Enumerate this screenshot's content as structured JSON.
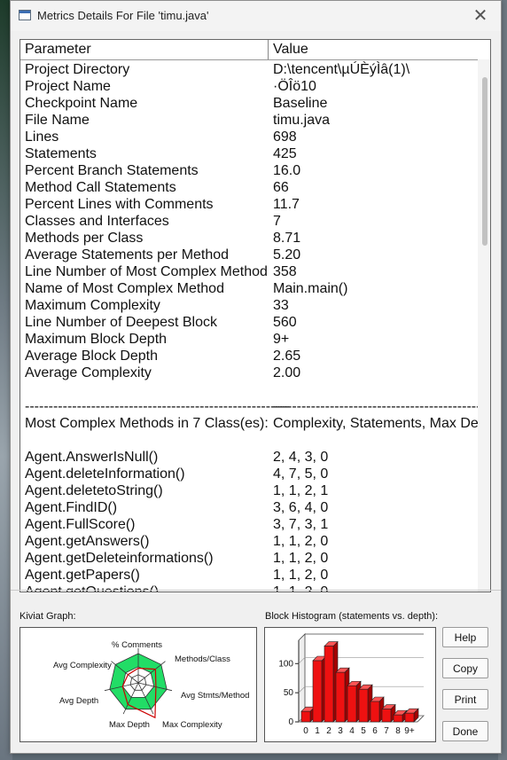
{
  "window": {
    "title": "Metrics Details For File 'timu.java'"
  },
  "table": {
    "headers": {
      "parameter": "Parameter",
      "value": "Value"
    },
    "rows": [
      {
        "p": "Project Directory",
        "v": "D:\\tencent\\µÚÈýÌâ(1)\\"
      },
      {
        "p": "Project Name",
        "v": "·ÖÎö10"
      },
      {
        "p": "Checkpoint Name",
        "v": "Baseline"
      },
      {
        "p": "File Name",
        "v": "timu.java"
      },
      {
        "p": "Lines",
        "v": "698"
      },
      {
        "p": "Statements",
        "v": "425"
      },
      {
        "p": "Percent Branch Statements",
        "v": "16.0"
      },
      {
        "p": "Method Call Statements",
        "v": "66"
      },
      {
        "p": "Percent Lines with Comments",
        "v": "11.7"
      },
      {
        "p": "Classes and Interfaces",
        "v": "7"
      },
      {
        "p": "Methods per Class",
        "v": "8.71"
      },
      {
        "p": "Average Statements per Method",
        "v": "5.20"
      },
      {
        "p": "Line Number of Most Complex Method",
        "v": "358"
      },
      {
        "p": "Name of Most Complex Method",
        "v": "Main.main()"
      },
      {
        "p": "Maximum Complexity",
        "v": "33"
      },
      {
        "p": "Line Number of Deepest Block",
        "v": "560"
      },
      {
        "p": "Maximum Block Depth",
        "v": "9+"
      },
      {
        "p": "Average Block Depth",
        "v": "2.65"
      },
      {
        "p": "Average Complexity",
        "v": "2.00"
      },
      {
        "p": "",
        "v": ""
      },
      {
        "p": "--------------------------------------------------------",
        "v": "---------------------------------------------------------"
      },
      {
        "p": "Most Complex Methods in 7 Class(es):",
        "v": "Complexity, Statements, Max Depth"
      },
      {
        "p": "",
        "v": ""
      },
      {
        "p": "Agent.AnswerIsNull()",
        "v": "2, 4, 3, 0"
      },
      {
        "p": "Agent.deleteInformation()",
        "v": "4, 7, 5, 0"
      },
      {
        "p": "Agent.deletetoString()",
        "v": "1, 1, 2, 1"
      },
      {
        "p": "Agent.FindID()",
        "v": "3, 6, 4, 0"
      },
      {
        "p": "Agent.FullScore()",
        "v": "3, 7, 3, 1"
      },
      {
        "p": "Agent.getAnswers()",
        "v": "1, 1, 2, 0"
      },
      {
        "p": "Agent.getDeleteinformations()",
        "v": "1, 1, 2, 0"
      },
      {
        "p": "Agent.getPapers()",
        "v": "1, 1, 2, 0"
      },
      {
        "p": "Agent.getQuestions()",
        "v": "1, 1, 2, 0"
      }
    ]
  },
  "kiviat": {
    "label": "Kiviat Graph:",
    "axes": [
      "% Comments",
      "Methods/Class",
      "Avg Stmts/Method",
      "Max Complexity",
      "Max Depth",
      "Avg Depth",
      "Avg Complexity"
    ]
  },
  "histogram": {
    "label": "Block Histogram (statements vs. depth):"
  },
  "chart_data": {
    "type": "bar",
    "title": "Block Histogram (statements vs. depth):",
    "categories": [
      "0",
      "1",
      "2",
      "3",
      "4",
      "5",
      "6",
      "7",
      "8",
      "9+"
    ],
    "values": [
      18,
      105,
      130,
      85,
      62,
      56,
      35,
      22,
      12,
      15
    ],
    "yticks": [
      "0",
      "50",
      "100"
    ],
    "ylim": [
      0,
      140
    ]
  },
  "buttons": {
    "help": "Help",
    "copy": "Copy",
    "print": "Print",
    "done": "Done"
  },
  "colors": {
    "bar": "#ee1111",
    "kiviat_fill": "#22dd66",
    "kiviat_polygon": "#cc0000"
  }
}
